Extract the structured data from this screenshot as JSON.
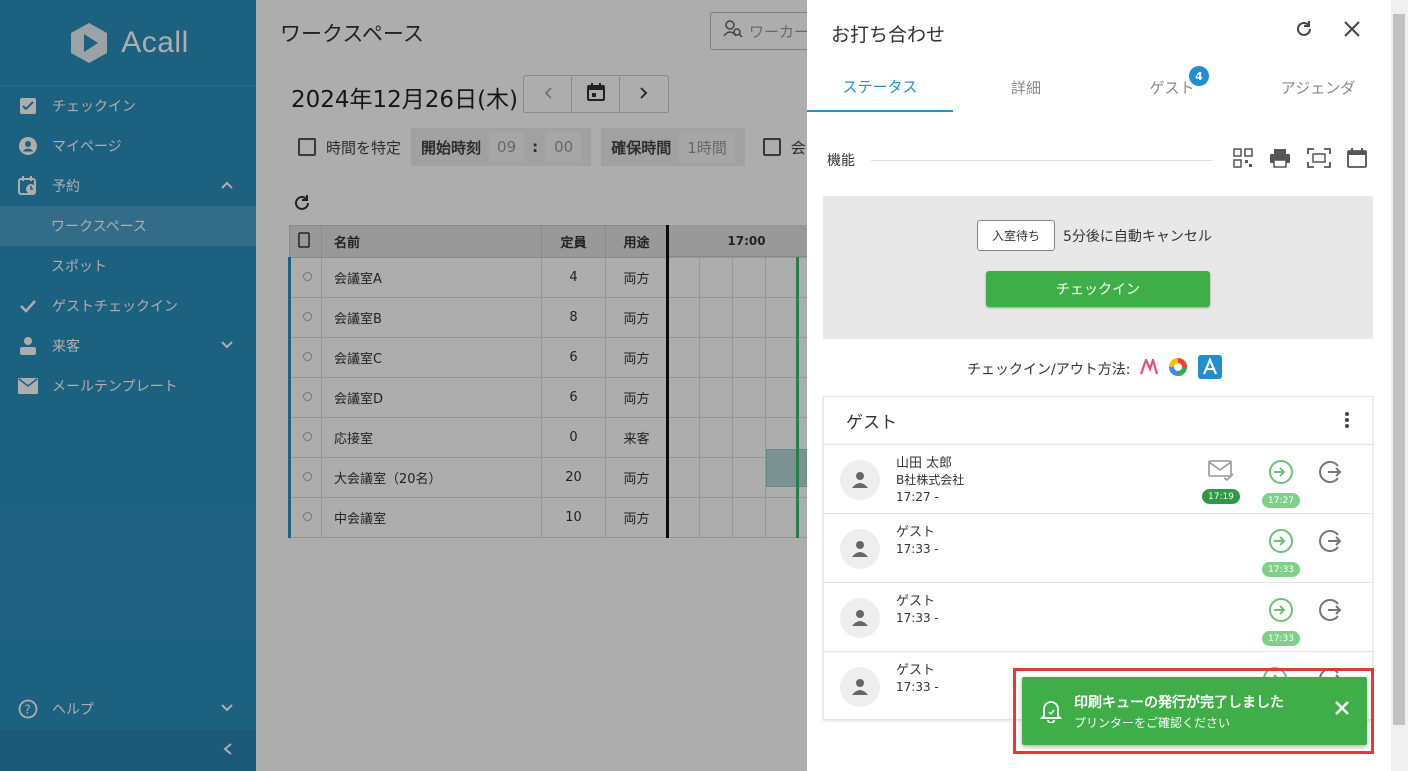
{
  "sidebar": {
    "logo_text": "Acall",
    "items": [
      {
        "label": "チェックイン"
      },
      {
        "label": "マイページ"
      },
      {
        "label": "予約"
      },
      {
        "label": "ワークスペース"
      },
      {
        "label": "スポット"
      },
      {
        "label": "ゲストチェックイン"
      },
      {
        "label": "来客"
      },
      {
        "label": "メールテンプレート"
      }
    ],
    "help_label": "ヘルプ"
  },
  "main": {
    "title": "ワークスペース",
    "search_placeholder": "ワーカー",
    "date": "2024年12月26日(木)",
    "filter_time_label": "時間を特定",
    "start_time_label": "開始時刻",
    "start_hour": "09",
    "start_colon": ":",
    "start_min": "00",
    "duration_label": "確保時間",
    "duration_value": "1時間",
    "extra_filter_label": "会",
    "table_headers": {
      "name": "名前",
      "capacity": "定員",
      "usage": "用途"
    },
    "timeline_label": "17:00",
    "rows": [
      {
        "name": "会議室A",
        "capacity": "4",
        "usage": "両方"
      },
      {
        "name": "会議室B",
        "capacity": "8",
        "usage": "両方"
      },
      {
        "name": "会議室C",
        "capacity": "6",
        "usage": "両方"
      },
      {
        "name": "会議室D",
        "capacity": "6",
        "usage": "両方"
      },
      {
        "name": "応接室",
        "capacity": "0",
        "usage": "来客"
      },
      {
        "name": "大会議室（20名）",
        "capacity": "20",
        "usage": "両方"
      },
      {
        "name": "中会議室",
        "capacity": "10",
        "usage": "両方"
      }
    ]
  },
  "panel": {
    "title": "お打ち合わせ",
    "tabs": [
      {
        "label": "ステータス"
      },
      {
        "label": "詳細"
      },
      {
        "label": "ゲスト"
      },
      {
        "label": "アジェンダ"
      }
    ],
    "guest_badge": "4",
    "features_label": "機能",
    "waiting_tag": "入室待ち",
    "waiting_text": "5分後に自動キャンセル",
    "checkin_button": "チェックイン",
    "methods_label": "チェックイン/アウト方法:",
    "guests_title": "ゲスト",
    "guests": [
      {
        "name": "山田 太郎",
        "company": "B社株式会社",
        "time": "17:27 -",
        "mail_time": "17:19",
        "in_time": "17:27"
      },
      {
        "name": "ゲスト",
        "company": "",
        "time": "17:33 -",
        "mail_time": "",
        "in_time": "17:33"
      },
      {
        "name": "ゲスト",
        "company": "",
        "time": "17:33 -",
        "mail_time": "",
        "in_time": "17:33"
      },
      {
        "name": "ゲスト",
        "company": "",
        "time": "17:33 -",
        "mail_time": "",
        "in_time": ""
      }
    ]
  },
  "toast": {
    "title": "印刷キューの発行が完了しました",
    "subtitle": "プリンターをご確認ください"
  },
  "colors": {
    "sidebar": "#2c8fbf",
    "accent": "#2592c9",
    "success": "#3fae49",
    "highlight": "#e53935"
  }
}
